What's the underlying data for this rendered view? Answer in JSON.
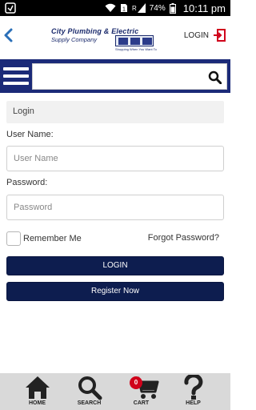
{
  "status_bar": {
    "battery": "74%",
    "time": "10:11 pm",
    "network": "R"
  },
  "header": {
    "logo_line1": "City Plumbing & Electric",
    "logo_line2": "Supply Company",
    "logo_tagline": "Shopping When You Want To",
    "login_label": "LOGIN"
  },
  "search": {
    "placeholder": ""
  },
  "login_form": {
    "panel_title": "Login",
    "username_label": "User Name:",
    "username_placeholder": "User Name",
    "password_label": "Password:",
    "password_placeholder": "Password",
    "remember_label": "Remember Me",
    "forgot_label": "Forgot Password?",
    "login_button": "LOGIN",
    "register_button": "Register Now"
  },
  "bottom_nav": {
    "home": "HOME",
    "search": "SEARCH",
    "cart": "CART",
    "cart_count": "0",
    "help": "HELP"
  },
  "colors": {
    "brand_navy": "#1b2a78",
    "button_navy": "#0d1d4f",
    "badge_red": "#d0021b",
    "login_icon_red": "#d0021b",
    "back_arrow_blue": "#2a6fb8"
  }
}
